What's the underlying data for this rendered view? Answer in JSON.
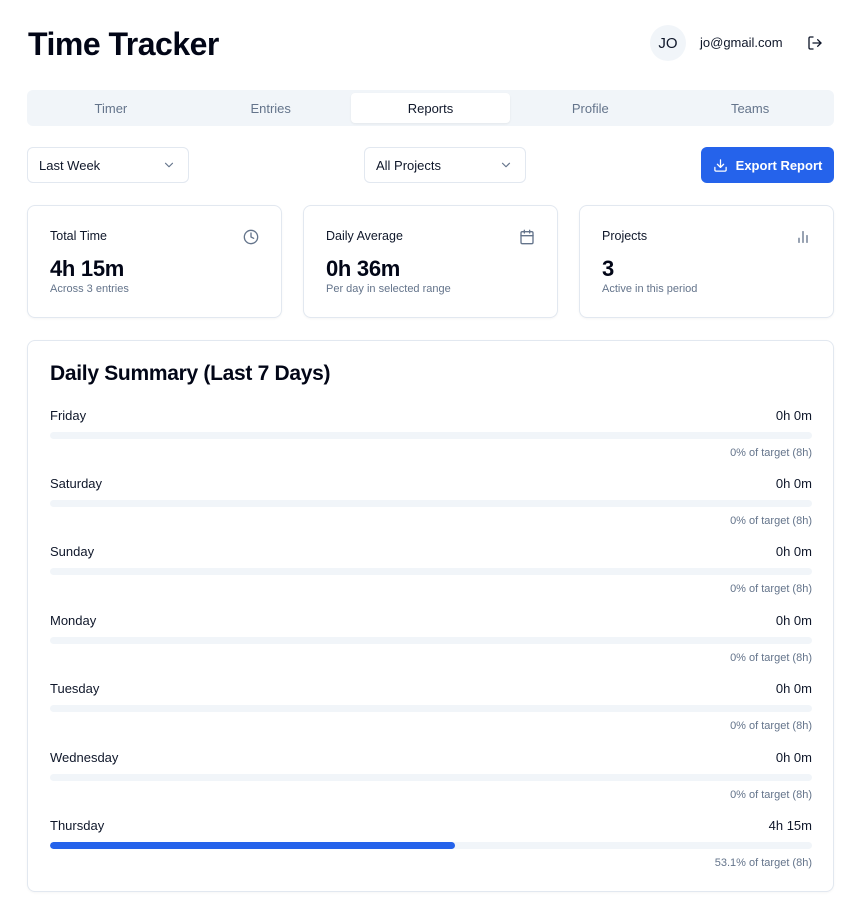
{
  "app": {
    "title": "Time Tracker"
  },
  "user": {
    "initials": "JO",
    "email": "jo@gmail.com",
    "logout_icon": "log-out-icon"
  },
  "tabs": [
    {
      "label": "Timer",
      "active": false
    },
    {
      "label": "Entries",
      "active": false
    },
    {
      "label": "Reports",
      "active": true
    },
    {
      "label": "Profile",
      "active": false
    },
    {
      "label": "Teams",
      "active": false
    }
  ],
  "filters": {
    "range": {
      "value": "Last Week"
    },
    "project": {
      "value": "All Projects"
    },
    "export_label": "Export Report"
  },
  "stats": [
    {
      "label": "Total Time",
      "value": "4h 15m",
      "sub": "Across 3 entries",
      "icon": "clock-icon"
    },
    {
      "label": "Daily Average",
      "value": "0h 36m",
      "sub": "Per day in selected range",
      "icon": "calendar-icon"
    },
    {
      "label": "Projects",
      "value": "3",
      "sub": "Active in this period",
      "icon": "bar-chart-icon"
    }
  ],
  "summary": {
    "title": "Daily Summary (Last 7 Days)",
    "days": [
      {
        "name": "Friday",
        "time": "0h 0m",
        "pct_text": "0% of target (8h)",
        "pct": 0
      },
      {
        "name": "Saturday",
        "time": "0h 0m",
        "pct_text": "0% of target (8h)",
        "pct": 0
      },
      {
        "name": "Sunday",
        "time": "0h 0m",
        "pct_text": "0% of target (8h)",
        "pct": 0
      },
      {
        "name": "Monday",
        "time": "0h 0m",
        "pct_text": "0% of target (8h)",
        "pct": 0
      },
      {
        "name": "Tuesday",
        "time": "0h 0m",
        "pct_text": "0% of target (8h)",
        "pct": 0
      },
      {
        "name": "Wednesday",
        "time": "0h 0m",
        "pct_text": "0% of target (8h)",
        "pct": 0
      },
      {
        "name": "Thursday",
        "time": "4h 15m",
        "pct_text": "53.1% of target (8h)",
        "pct": 53.1
      }
    ]
  },
  "colors": {
    "accent": "#2563eb",
    "track": "#f1f5f9",
    "muted": "#64748b"
  }
}
